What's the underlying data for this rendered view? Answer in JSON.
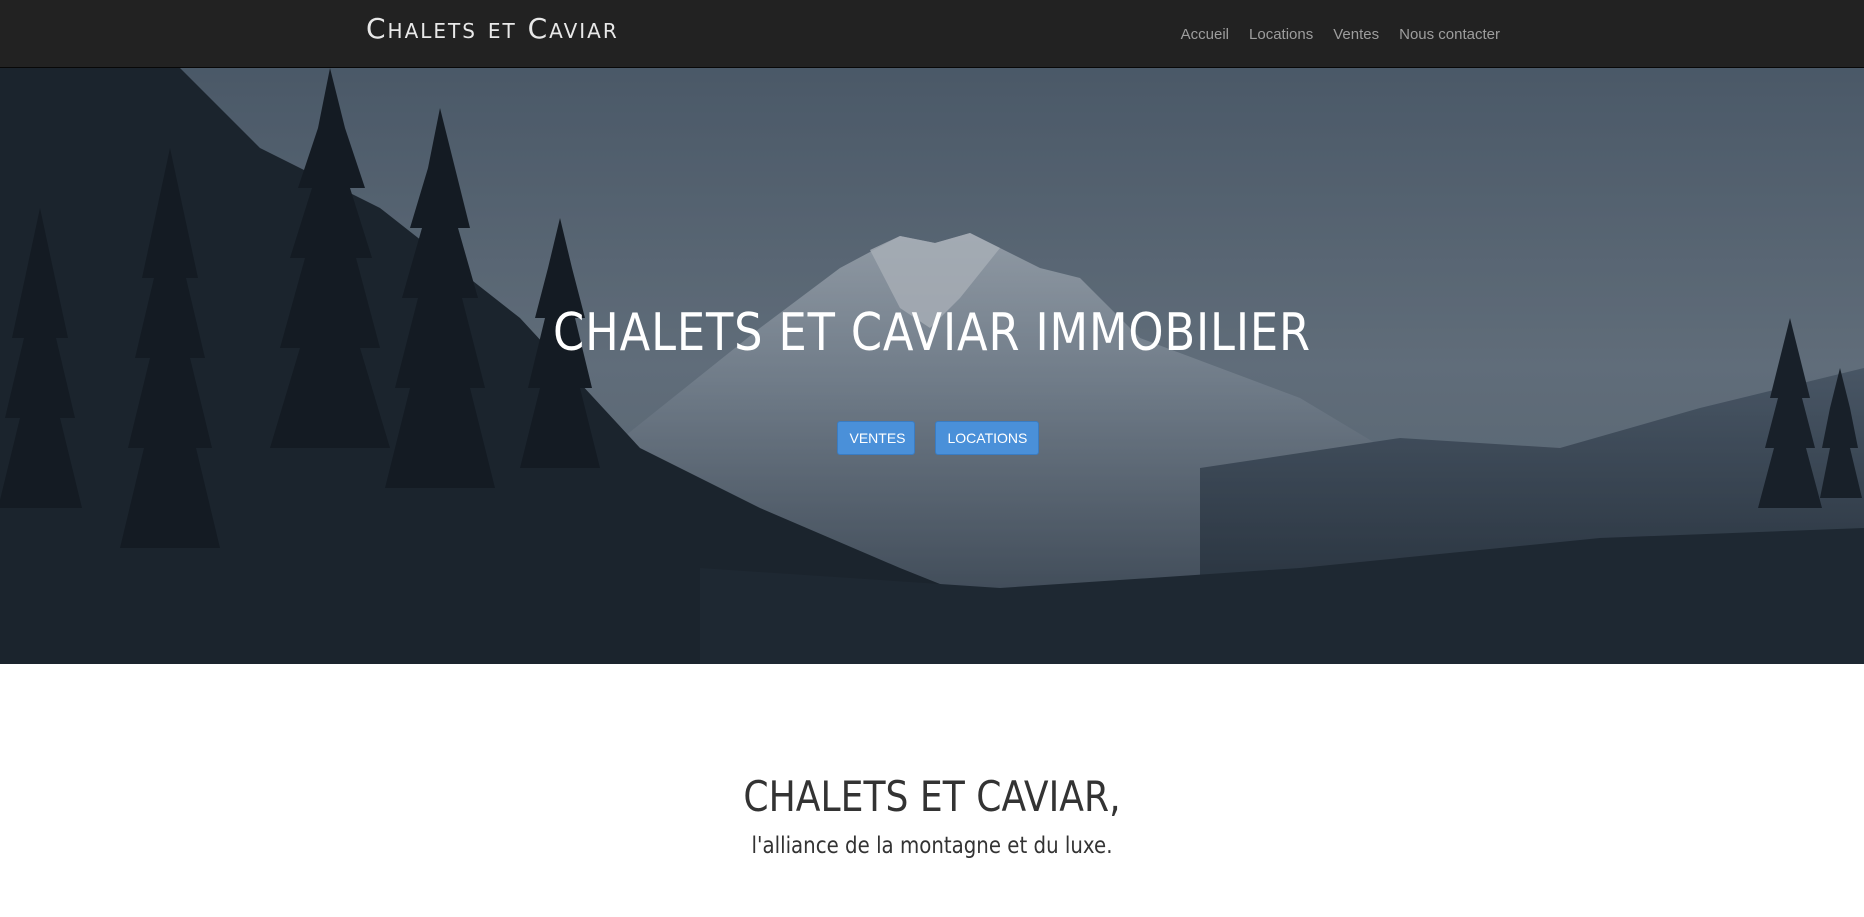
{
  "navbar": {
    "brand": "Chalets et Caviar",
    "links": [
      "Accueil",
      "Locations",
      "Ventes",
      "Nous contacter"
    ]
  },
  "hero": {
    "title": "CHALETS ET CAVIAR IMMOBILIER",
    "buttons": [
      "VENTES",
      "LOCATIONS"
    ]
  },
  "intro": {
    "title": "CHALETS ET CAVIAR,",
    "subtitle": "l'alliance de la montagne et du luxe."
  },
  "colors": {
    "navbar_bg": "#222222",
    "nav_link": "#9d9d9d",
    "button": "#4a90d9",
    "text_dark": "#333333"
  }
}
